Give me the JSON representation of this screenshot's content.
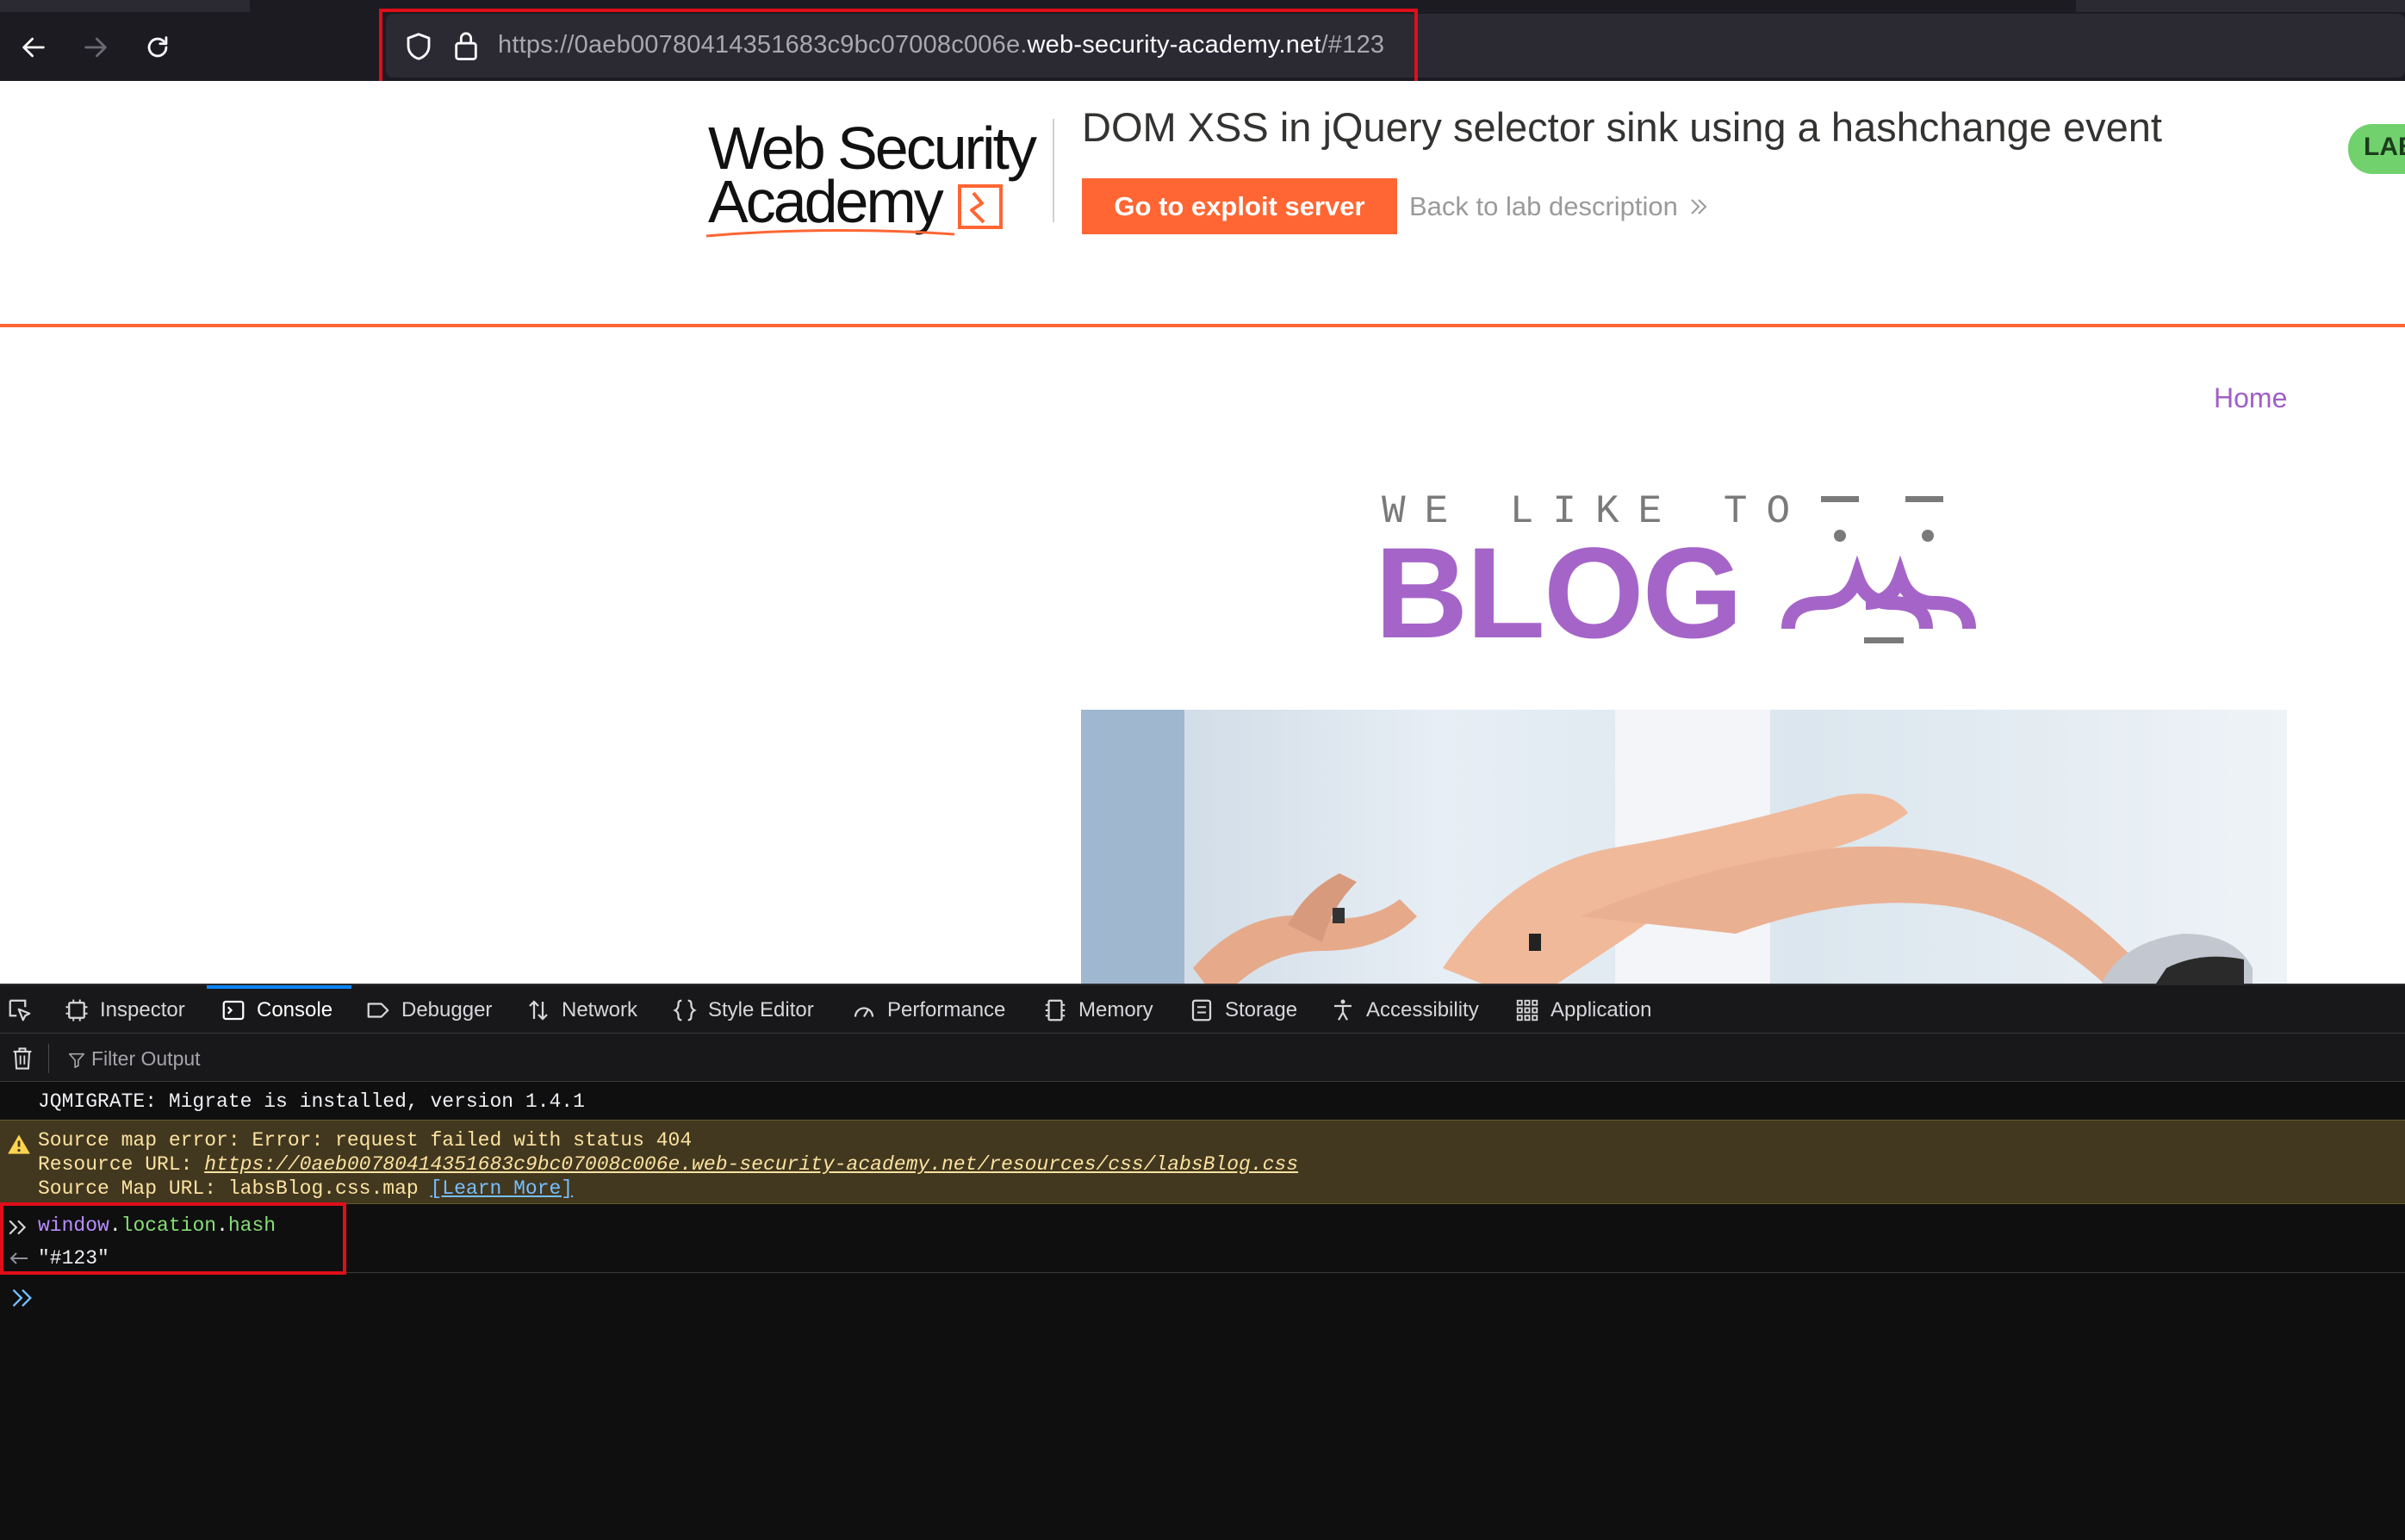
{
  "browser": {
    "url_prefix": "https://0aeb00780414351683c9bc07008c006e.",
    "url_host": "web-security-academy.net",
    "url_suffix": "/#123"
  },
  "page": {
    "logo_text": [
      "Web Security",
      "Academy"
    ],
    "lab_title": "DOM XSS in jQuery selector sink using a hashchange event",
    "exploit_button": "Go to exploit server",
    "back_link": "Back to lab description",
    "lab_badge": "LAB",
    "home_link": "Home",
    "blog_logo": {
      "top_text": "WE LIKE TO",
      "main_text": "BLOG"
    }
  },
  "devtools": {
    "tabs": [
      {
        "label": "Inspector",
        "icon": "inspector-icon"
      },
      {
        "label": "Console",
        "icon": "console-icon",
        "active": true
      },
      {
        "label": "Debugger",
        "icon": "debugger-icon"
      },
      {
        "label": "Network",
        "icon": "network-icon"
      },
      {
        "label": "Style Editor",
        "icon": "style-editor-icon"
      },
      {
        "label": "Performance",
        "icon": "performance-icon"
      },
      {
        "label": "Memory",
        "icon": "memory-icon"
      },
      {
        "label": "Storage",
        "icon": "storage-icon"
      },
      {
        "label": "Accessibility",
        "icon": "accessibility-icon"
      },
      {
        "label": "Application",
        "icon": "application-icon"
      }
    ],
    "filter_placeholder": "Filter Output",
    "console": {
      "log": "JQMIGRATE: Migrate is installed, version 1.4.1",
      "warning": {
        "line1": "Source map error: Error: request failed with status 404",
        "line2_label": "Resource URL: ",
        "line2_url": "https://0aeb00780414351683c9bc07008c006e.web-security-academy.net/resources/css/labsBlog.css",
        "line3_label": "Source Map URL: labsBlog.css.map ",
        "line3_link": "[Learn More]"
      },
      "command": {
        "object": "window",
        "dot1": ".",
        "prop1": "location",
        "dot2": ".",
        "prop2": "hash"
      },
      "result": "\"#123\""
    }
  },
  "colors": {
    "accent_orange": "#ff6633",
    "blog_purple": "#a05fc4",
    "highlight_red": "#e00e1a",
    "devtools_blue": "#0a84ff"
  }
}
